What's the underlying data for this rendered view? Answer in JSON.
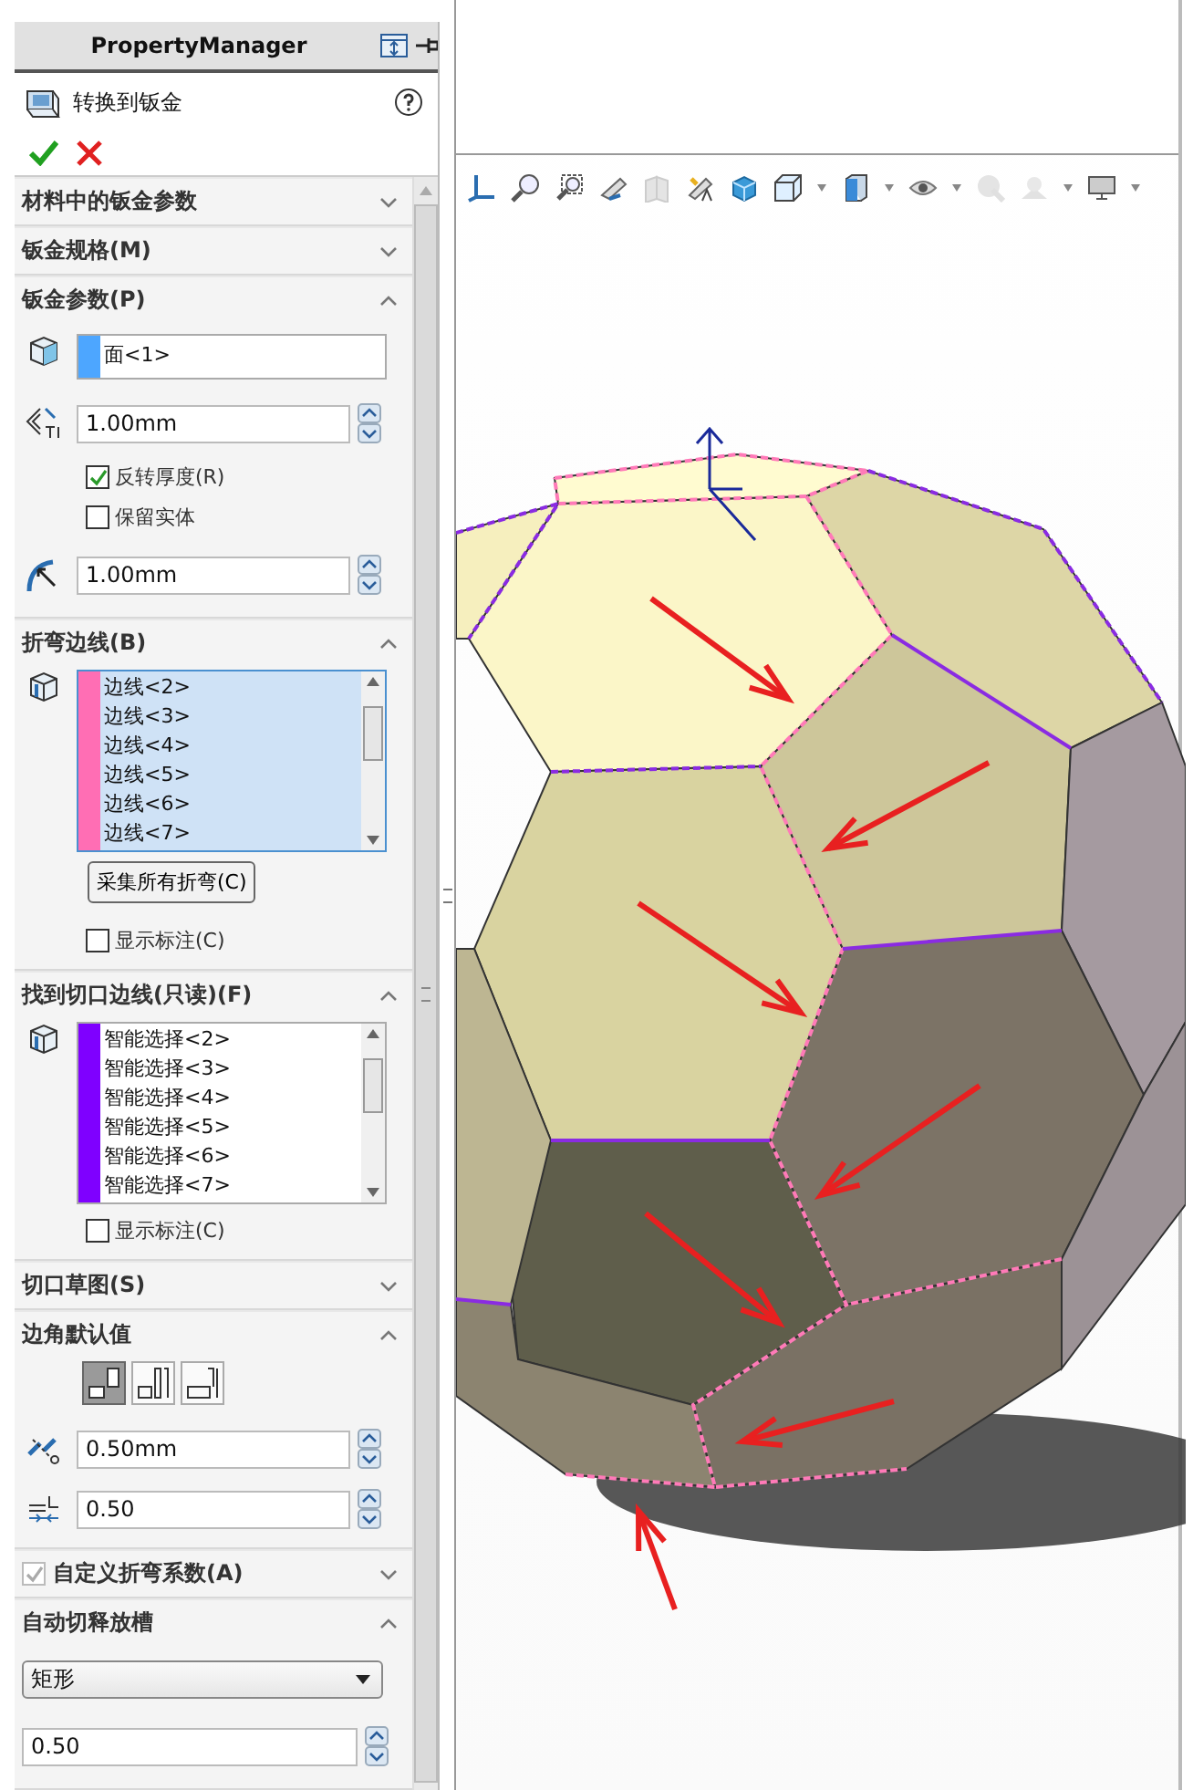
{
  "panel_header": {
    "title": "PropertyManager"
  },
  "feature": {
    "title": "转换到钣金"
  },
  "sections": [
    {
      "title": "材料中的钣金参数",
      "expanded": false
    },
    {
      "title": "钣金规格(M)",
      "expanded": false
    },
    {
      "title": "钣金参数(P)",
      "expanded": true,
      "items": [
        {
          "kind": "selection",
          "color": "#4da6ff",
          "selected": false,
          "entries": [
            "面<1>"
          ]
        },
        {
          "kind": "thickness",
          "value": "1.00mm"
        },
        {
          "kind": "checkbox",
          "label": "反转厚度(R)",
          "checked": true
        },
        {
          "kind": "checkbox",
          "label": "保留实体",
          "checked": false
        },
        {
          "kind": "radius",
          "value": "1.00mm"
        }
      ]
    },
    {
      "title": "折弯边线(B)",
      "expanded": true,
      "items": [
        {
          "kind": "selection",
          "color": "#ff6eb4",
          "selected": true,
          "entries": [
            "边线<2>",
            "边线<3>",
            "边线<4>",
            "边线<5>",
            "边线<6>",
            "边线<7>"
          ]
        },
        {
          "kind": "button",
          "label": "采集所有折弯(C)"
        },
        {
          "kind": "checkbox",
          "label": "显示标注(C)",
          "checked": false
        }
      ]
    },
    {
      "title": "找到切口边线(只读)(F)",
      "expanded": true,
      "items": [
        {
          "kind": "selection",
          "color": "#7f00ff",
          "selected": false,
          "entries": [
            "智能选择<2>",
            "智能选择<3>",
            "智能选择<4>",
            "智能选择<5>",
            "智能选择<6>",
            "智能选择<7>"
          ]
        },
        {
          "kind": "checkbox",
          "label": "显示标注(C)",
          "checked": false
        }
      ]
    },
    {
      "title": "切口草图(S)",
      "expanded": false
    },
    {
      "title": "边角默认值",
      "expanded": true,
      "items": [
        {
          "kind": "corner-options",
          "options": [
            {
              "selected": true
            },
            {
              "selected": false
            },
            {
              "selected": false
            }
          ]
        },
        {
          "kind": "gap",
          "value": "0.50mm"
        },
        {
          "kind": "ratio",
          "value": "0.50"
        }
      ]
    },
    {
      "title": "自定义折弯系数(A)",
      "expanded": false,
      "checkbox": {
        "checked": true,
        "disabled": true
      }
    },
    {
      "title": "自动切释放槽",
      "expanded": true,
      "items": [
        {
          "kind": "dropdown",
          "value": "矩形"
        },
        {
          "kind": "plain",
          "value": "0.50"
        }
      ]
    }
  ]
}
